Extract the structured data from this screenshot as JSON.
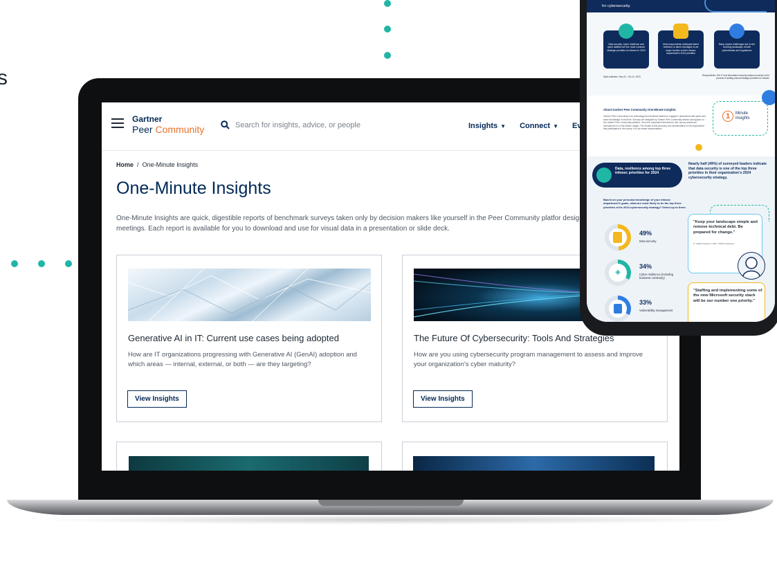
{
  "colors": {
    "navy": "#002856",
    "teal": "#1fb6a6",
    "orange": "#e8702a",
    "yellow": "#f2b81e",
    "blue": "#2f7de1"
  },
  "edge_text": "s",
  "site": {
    "logo_top": "Gartner",
    "logo_peer": "Peer",
    "logo_community": "Community",
    "search_placeholder": "Search for insights, advice, or people",
    "nav": [
      "Insights",
      "Connect",
      "Events"
    ]
  },
  "breadcrumb": {
    "home": "Home",
    "current": "One-Minute Insights"
  },
  "page": {
    "title": "One-Minute Insights",
    "intro": "One-Minute Insights are quick, digestible reports of benchmark surveys taken only by decision makers like yourself in the Peer Community platfor designed to be read between meetings. Each report is available for you to download and use for visual data in a presentation or slide deck."
  },
  "cards": [
    {
      "title": "Generative AI in IT: Current use cases being adopted",
      "desc": "How are IT organizations progressing with Generative AI (GenAI) adoption and which areas — internal, external, or both — are they targeting?",
      "button": "View Insights"
    },
    {
      "title": "The Future Of Cybersecurity: Tools And Strategies",
      "desc": "How are you using cybersecurity program management to assess and improve your organization's cyber maturity?",
      "button": "View Insights"
    }
  ],
  "phone": {
    "header_line": "for cybersecurity.",
    "tiles": [
      "Data security, cyber resilience and cyber abilities are the most common strategic priorities for infosec in 2024",
      "Most respondents anticipate talent retention or talent shortages to be major hurdles to their infosec department's 2024 priorities",
      "Many expect challenges due to the evolving landscape of both cyberthreats and regulations"
    ],
    "data_collection": "Data collection: Sep 24 - Oct 11, 2023",
    "respondents": "Respondents: 154 IT and information security leaders involved in the process of setting annual strategic priorities for infosec",
    "about_title": "About Gartner Peer Community One-Minute Insights:",
    "about_body": "Gartner Peer Community is for technology and business leaders to engage in discussions with peers and share knowledge in real time. Surveys are designed by Gartner Peer Community editors and appear on the Gartner Peer Community platform. Once the respondent threshold is met, survey results are summarized in a One-Minute Insight. The results of this summary are representative of the respondents that participated in the survey. It is not meant representative.",
    "badge_number": "1",
    "badge_l1": "Minute",
    "badge_l2": "Insights",
    "pill_text": "Data, resilience among top three infosec priorities for 2024",
    "half_text_pre": "Nearly half (",
    "half_pct": "49%",
    "half_text_mid": ") of surveyed leaders indicate that ",
    "half_bold": "data security",
    "half_text_post": " is one of the top three priorities in their organization's 2024 cybersecurity strategy.",
    "question": "Based on your personal knowledge of your infosec department's goals, what are most likely to be the top three priorities of its 2024 cybersecurity strategy? Select up to three.",
    "stats": [
      {
        "pct": "49%",
        "label": "Data security",
        "value": 49
      },
      {
        "pct": "34%",
        "label": "Cyber resilience (including business continuity)",
        "value": 34
      },
      {
        "pct": "33%",
        "label": "Vulnerability management",
        "value": 33
      }
    ],
    "quote1": "\"Keep your landscape simple and remove technical debt. Be prepared for change.\"",
    "quote1_attr": "IT, utilities industry, 1,000 - 5,000 employees",
    "quote2": "\"Staffing and implementing some of the new Microsoft security stack will be our number one priority.\""
  }
}
